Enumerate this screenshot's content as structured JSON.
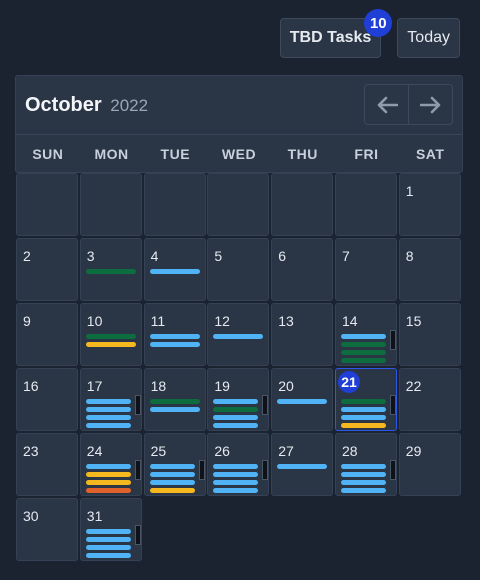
{
  "toolbar": {
    "tbd_label": "TBD Tasks",
    "tbd_count": "10",
    "today_label": "Today"
  },
  "calendar": {
    "month": "October",
    "year": "2022",
    "weekdays": [
      "SUN",
      "MON",
      "TUE",
      "WED",
      "THU",
      "FRI",
      "SAT"
    ],
    "today": "21",
    "colors": {
      "blue": "#4fb3f5",
      "green": "#0d6d3e",
      "yellow": "#f5b81e",
      "orange": "#e0622a",
      "today": "#1f3fd6"
    },
    "days": [
      {
        "day": "1",
        "bars": [],
        "more": false
      },
      {
        "day": "2",
        "bars": [],
        "more": false
      },
      {
        "day": "3",
        "bars": [
          "green"
        ],
        "more": false
      },
      {
        "day": "4",
        "bars": [
          "blue"
        ],
        "more": false
      },
      {
        "day": "5",
        "bars": [],
        "more": false
      },
      {
        "day": "6",
        "bars": [],
        "more": false
      },
      {
        "day": "7",
        "bars": [],
        "more": false
      },
      {
        "day": "8",
        "bars": [],
        "more": false
      },
      {
        "day": "9",
        "bars": [],
        "more": false
      },
      {
        "day": "10",
        "bars": [
          "green",
          "yellow"
        ],
        "more": false
      },
      {
        "day": "11",
        "bars": [
          "blue",
          "blue"
        ],
        "more": false
      },
      {
        "day": "12",
        "bars": [
          "blue"
        ],
        "more": false
      },
      {
        "day": "13",
        "bars": [],
        "more": false
      },
      {
        "day": "14",
        "bars": [
          "blue",
          "green",
          "green",
          "green"
        ],
        "more": true
      },
      {
        "day": "15",
        "bars": [],
        "more": false
      },
      {
        "day": "16",
        "bars": [],
        "more": false
      },
      {
        "day": "17",
        "bars": [
          "blue",
          "blue",
          "blue",
          "blue"
        ],
        "more": true
      },
      {
        "day": "18",
        "bars": [
          "green",
          "blue"
        ],
        "more": false
      },
      {
        "day": "19",
        "bars": [
          "blue",
          "green",
          "blue",
          "blue"
        ],
        "more": true
      },
      {
        "day": "20",
        "bars": [
          "blue"
        ],
        "more": false
      },
      {
        "day": "21",
        "bars": [
          "green",
          "blue",
          "blue",
          "yellow"
        ],
        "more": true
      },
      {
        "day": "22",
        "bars": [],
        "more": false
      },
      {
        "day": "23",
        "bars": [],
        "more": false
      },
      {
        "day": "24",
        "bars": [
          "blue",
          "yellow",
          "yellow",
          "orange"
        ],
        "more": true
      },
      {
        "day": "25",
        "bars": [
          "blue",
          "blue",
          "blue",
          "yellow"
        ],
        "more": true
      },
      {
        "day": "26",
        "bars": [
          "blue",
          "blue",
          "blue",
          "blue"
        ],
        "more": true
      },
      {
        "day": "27",
        "bars": [
          "blue"
        ],
        "more": false
      },
      {
        "day": "28",
        "bars": [
          "blue",
          "blue",
          "blue",
          "blue"
        ],
        "more": true
      },
      {
        "day": "29",
        "bars": [],
        "more": false
      },
      {
        "day": "30",
        "bars": [],
        "more": false
      },
      {
        "day": "31",
        "bars": [
          "blue",
          "blue",
          "blue",
          "blue"
        ],
        "more": true
      }
    ]
  }
}
